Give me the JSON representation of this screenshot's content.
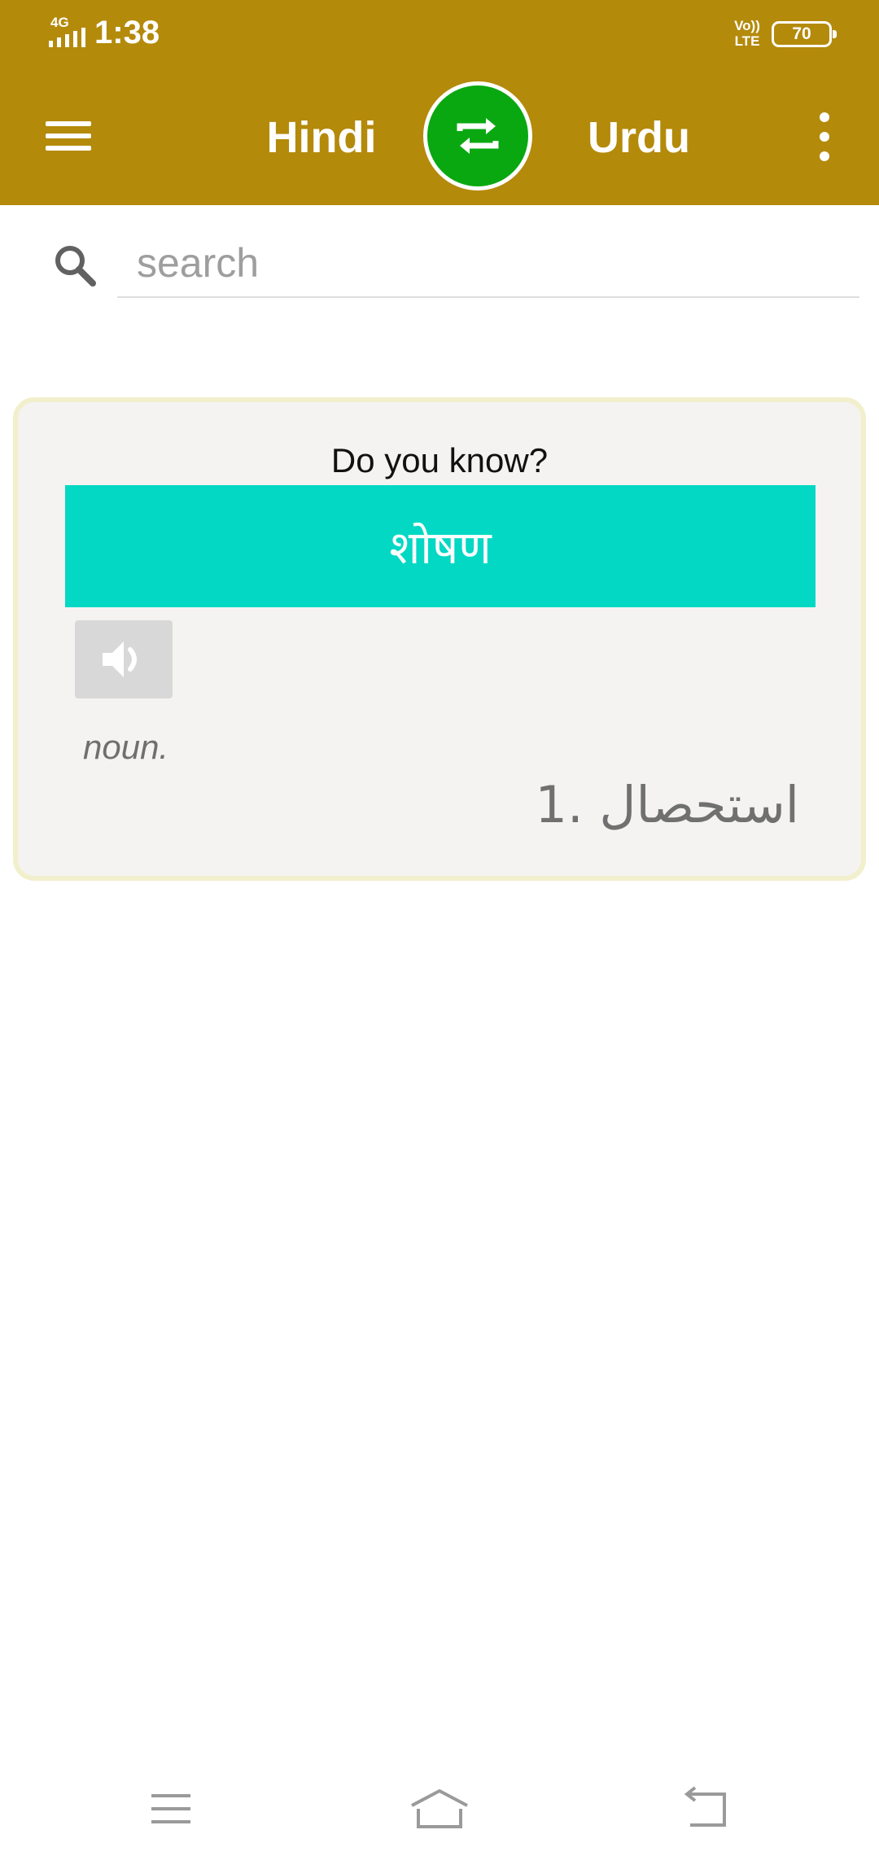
{
  "status_bar": {
    "network": "4G",
    "time": "1:38",
    "volte": "Vo)) LTE",
    "battery": "70"
  },
  "app_bar": {
    "source_language": "Hindi",
    "target_language": "Urdu"
  },
  "search": {
    "placeholder": "search",
    "value": ""
  },
  "word_card": {
    "title": "Do you know?",
    "word": "शोषण",
    "part_of_speech": "noun.",
    "meanings": [
      "1. استحصال"
    ]
  },
  "colors": {
    "app_bar": "#b48a0b",
    "swap_button": "#09a811",
    "word_banner": "#02d8c4",
    "card_background": "#f4f3f1",
    "card_border": "#f2efcd"
  },
  "icons": {
    "menu": "hamburger-icon",
    "swap": "swap-arrows-icon",
    "overflow": "more-vert-icon",
    "search": "search-icon",
    "speaker": "speaker-icon",
    "nav_menu": "recents-icon",
    "nav_home": "home-icon",
    "nav_back": "back-icon"
  }
}
